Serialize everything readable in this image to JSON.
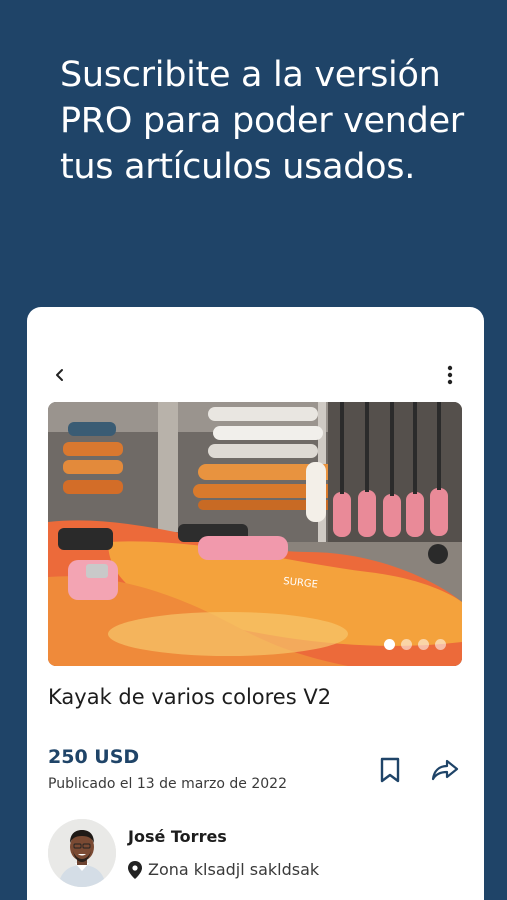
{
  "promo": {
    "headline": "Suscribite a la versión PRO para poder vender tus artículos usados."
  },
  "listing": {
    "title": "Kayak de varios colores V2",
    "price": "250 USD",
    "published": "Publicado el 13 de marzo de 2022",
    "image_count": 4,
    "active_image_index": 0
  },
  "seller": {
    "name": "José Torres",
    "location": "Zona klsadjl sakldsak"
  },
  "icons": {
    "back": "chevron-left-icon",
    "more": "more-vertical-icon",
    "bookmark": "bookmark-icon",
    "share": "share-icon",
    "location": "map-pin-icon"
  },
  "colors": {
    "background": "#1f4468",
    "card": "#ffffff",
    "price": "#1f4468",
    "text": "#1d1d1d"
  }
}
